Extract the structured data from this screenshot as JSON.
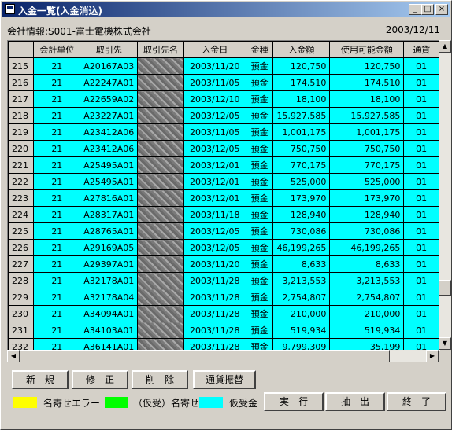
{
  "window": {
    "title": "入金一覧(入金消込)",
    "min": "_",
    "max": "□",
    "close": "×"
  },
  "header": {
    "company": "会社情報:S001-富士電機株式会社",
    "date": "2003/12/11"
  },
  "columns": [
    "",
    "会計単位",
    "取引先",
    "取引先名",
    "入金日",
    "金種",
    "入金額",
    "使用可能金額",
    "通貨"
  ],
  "rows": [
    [
      "215",
      "21",
      "A20167A03",
      "",
      "2003/11/20",
      "預金",
      "120,750",
      "120,750",
      "01"
    ],
    [
      "216",
      "21",
      "A22247A01",
      "",
      "2003/11/05",
      "預金",
      "174,510",
      "174,510",
      "01"
    ],
    [
      "217",
      "21",
      "A22659A02",
      "",
      "2003/12/10",
      "預金",
      "18,100",
      "18,100",
      "01"
    ],
    [
      "218",
      "21",
      "A23227A01",
      "",
      "2003/12/05",
      "預金",
      "15,927,585",
      "15,927,585",
      "01"
    ],
    [
      "219",
      "21",
      "A23412A06",
      "",
      "2003/11/05",
      "預金",
      "1,001,175",
      "1,001,175",
      "01"
    ],
    [
      "220",
      "21",
      "A23412A06",
      "",
      "2003/12/05",
      "預金",
      "750,750",
      "750,750",
      "01"
    ],
    [
      "221",
      "21",
      "A25495A01",
      "",
      "2003/12/01",
      "預金",
      "770,175",
      "770,175",
      "01"
    ],
    [
      "222",
      "21",
      "A25495A01",
      "",
      "2003/12/01",
      "預金",
      "525,000",
      "525,000",
      "01"
    ],
    [
      "223",
      "21",
      "A27816A01",
      "",
      "2003/12/01",
      "預金",
      "173,970",
      "173,970",
      "01"
    ],
    [
      "224",
      "21",
      "A28317A01",
      "",
      "2003/11/18",
      "預金",
      "128,940",
      "128,940",
      "01"
    ],
    [
      "225",
      "21",
      "A28765A01",
      "",
      "2003/12/05",
      "預金",
      "730,086",
      "730,086",
      "01"
    ],
    [
      "226",
      "21",
      "A29169A05",
      "",
      "2003/12/05",
      "預金",
      "46,199,265",
      "46,199,265",
      "01"
    ],
    [
      "227",
      "21",
      "A29397A01",
      "",
      "2003/11/20",
      "預金",
      "8,633",
      "8,633",
      "01"
    ],
    [
      "228",
      "21",
      "A32178A01",
      "",
      "2003/11/28",
      "預金",
      "3,213,553",
      "3,213,553",
      "01"
    ],
    [
      "229",
      "21",
      "A32178A04",
      "",
      "2003/11/28",
      "預金",
      "2,754,807",
      "2,754,807",
      "01"
    ],
    [
      "230",
      "21",
      "A34094A01",
      "",
      "2003/11/28",
      "預金",
      "210,000",
      "210,000",
      "01"
    ],
    [
      "231",
      "21",
      "A34103A01",
      "",
      "2003/11/28",
      "預金",
      "519,934",
      "519,934",
      "01"
    ],
    [
      "232",
      "21",
      "A36141A01",
      "",
      "2003/11/28",
      "預金",
      "9,799,309",
      "35,199",
      "01"
    ]
  ],
  "buttons": {
    "new": "新　規",
    "edit": "修　正",
    "delete": "削　除",
    "currency": "通貨振替",
    "execute": "実　行",
    "extract": "抽　出",
    "exit": "終　了"
  },
  "legend": [
    {
      "label": "名寄せエラー",
      "color": "#ffff00"
    },
    {
      "label": "（仮受）名寄せ",
      "color": "#00ff00"
    },
    {
      "label": "仮受金",
      "color": "#00ffff"
    }
  ]
}
